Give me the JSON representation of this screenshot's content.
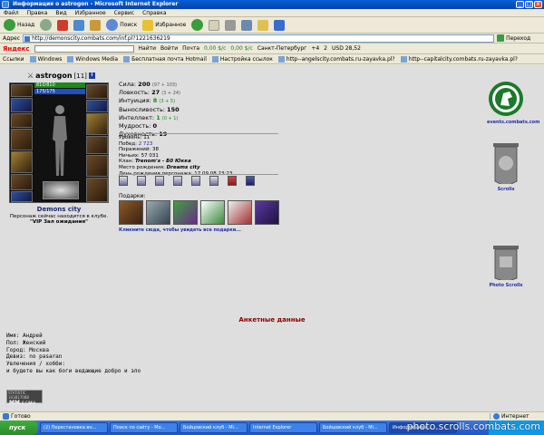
{
  "window": {
    "title": "Информация о astrogon - Microsoft Internet Explorer"
  },
  "menu": [
    "Файл",
    "Правка",
    "Вид",
    "Избранное",
    "Сервис",
    "Справка"
  ],
  "toolbar": {
    "back": "Назад",
    "search": "Поиск",
    "favorites": "Избранное"
  },
  "address": {
    "label": "Адрес",
    "url": "http://demonscity.combats.com/inf.pl?1221636219",
    "go": "Переход"
  },
  "yandex": {
    "logo": "Яндекс",
    "find": "Найти",
    "login": "Войти",
    "mail": "Почта",
    "rate1": "0,00 $/с",
    "rate2": "0,00 $/с",
    "city": "Санкт-Петербург",
    "temp": "+4",
    "num": "2",
    "usd": "USD 28,52"
  },
  "links": {
    "label": "Ссылки",
    "items": [
      "Windows",
      "Windows Media",
      "Бесплатная почта Hotmail",
      "Настройка ссылок",
      "http--angelscity.combats.ru-zayavka.pl?logs=12_03_07&filter=",
      "http--capitalcity.combats.ru-zayavka.pl?logs=12_03_07&filter="
    ]
  },
  "character": {
    "name": "astrogon",
    "level": "[11]",
    "hp": "810/810",
    "mp": "175/175",
    "city": "Demons city",
    "city_status": "Персонаж сейчас находится в клубе.",
    "location": "\"VIP Зал ожидания\""
  },
  "stats": [
    {
      "label": "Сила:",
      "value": "200",
      "extra": "(97 + 103)",
      "green": false
    },
    {
      "label": "Ловкость:",
      "value": "27",
      "extra": "(3 + 24)",
      "green": false
    },
    {
      "label": "Интуиция:",
      "value": "8",
      "extra": "(3 + 5)",
      "green": true
    },
    {
      "label": "Выносливость:",
      "value": "150",
      "extra": "",
      "green": false
    },
    {
      "label": "Интеллект:",
      "value": "1",
      "extra": "(0 + 1)",
      "green": true
    },
    {
      "label": "Мудрость:",
      "value": "0",
      "extra": "",
      "green": false
    },
    {
      "label": "Духовность:",
      "value": "19",
      "extra": "",
      "green": false
    }
  ],
  "info": {
    "level": "Уровень: 11",
    "wins_label": "Побед: ",
    "wins": "2 723",
    "losses": "Поражений: 38",
    "draws": "Ничьих: 57 031",
    "clan_label": "Клан: ",
    "clan": "Trenom's - Б0 Юкка",
    "birthplace_label": "Место рождения: ",
    "birthplace": "Dreams city",
    "birthday": "День рождения персонажа: 17.09.08 23:23"
  },
  "gifts": {
    "title": "Подарки:",
    "hint": "Кликните сюда, чтобы увидеть все подарки..."
  },
  "side_links": [
    "events.combats.com",
    "Scrolls",
    "Photo Scrolls"
  ],
  "profile": {
    "title": "Анкетные данные",
    "lines": [
      "Имя: Андрей",
      "Пол: Женский",
      "Город: Москва",
      "Девиз: no pasaran",
      "Увлечения / хобби:",
      "и будете вы как боги ведающие добро и зло"
    ]
  },
  "counter": {
    "top": "STATISTIC 103817088",
    "brand": "MM",
    "sub": "6 CIMIA"
  },
  "status": {
    "text": "Готово",
    "zone": "Интернет"
  },
  "taskbar": {
    "start": "пуск",
    "items": [
      "(2) Перестановка вн...",
      "Поиск по сайту - Mo...",
      "Бойцовский клуб - Mi...",
      "Internet Explorer",
      "Бойцовский клуб - Mi...",
      "Информация о..."
    ]
  },
  "watermark": "photo.scrolls.combats.com",
  "colors": {
    "link_blue": "#2030a0",
    "title_red": "#8b0000",
    "hp_green": "#1a8a1a",
    "mp_blue": "#2050c0"
  }
}
